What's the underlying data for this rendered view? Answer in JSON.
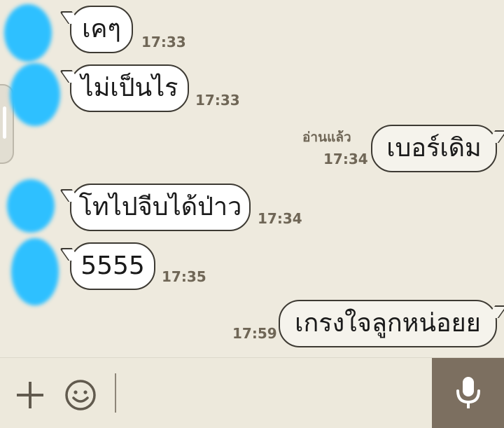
{
  "messages": [
    {
      "text": "เคๆ",
      "time": "17:33",
      "direction": "incoming"
    },
    {
      "text": "ไม่เป็นไร",
      "time": "17:33",
      "direction": "incoming"
    },
    {
      "text": "เบอร์เดิม",
      "time": "17:34",
      "direction": "outgoing",
      "read": "อ่านแล้ว"
    },
    {
      "text": "โทไปจีบได้ป่าว",
      "time": "17:34",
      "direction": "incoming"
    },
    {
      "text": "5555",
      "time": "17:35",
      "direction": "incoming"
    },
    {
      "text": "เกรงใจลูกหน่อยย",
      "time": "17:59",
      "direction": "outgoing"
    }
  ],
  "input_bar": {
    "icons": [
      "plus-icon",
      "emoji-icon",
      "microphone-icon"
    ]
  },
  "colors": {
    "background": "#eeeade",
    "bubble_border": "#3d3a33",
    "timestamp": "#6f6656",
    "avatar_blur": "#2ec0ff",
    "mic_button": "#7c6f60"
  }
}
